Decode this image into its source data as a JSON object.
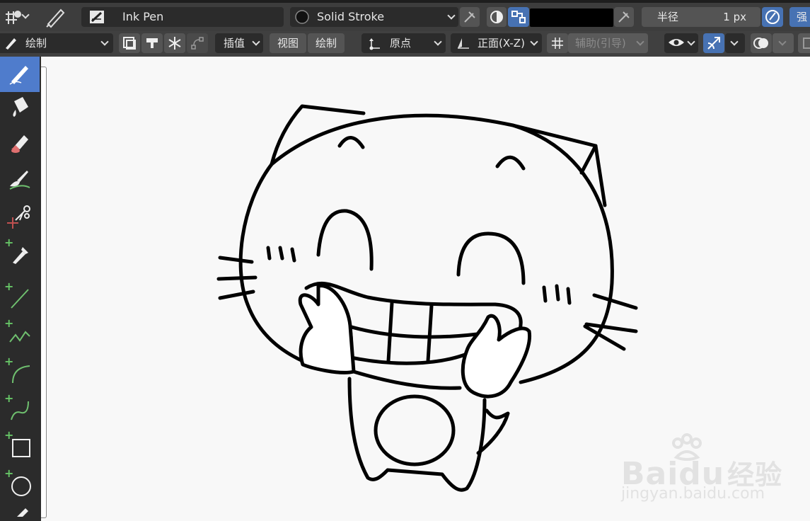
{
  "header": {
    "brush_name": "Ink Pen",
    "material_name": "Solid Stroke",
    "color_value": "#000000",
    "radius_label": "半径",
    "radius_value": "1 px",
    "strength_label_partial": "强"
  },
  "toolbar2": {
    "mode_label": "绘制",
    "interpolate_label": "插值",
    "view_menu": "视图",
    "draw_menu": "绘制",
    "origin_label": "原点",
    "plane_label": "正面(X-Z)",
    "guide_label": "辅助(引导)"
  },
  "tools": [
    {
      "name": "draw-tool",
      "icon": "pencil-icon"
    },
    {
      "name": "fill-tool",
      "icon": "paint-bucket-icon"
    },
    {
      "name": "erase-tool",
      "icon": "eraser-icon"
    },
    {
      "name": "tint-tool",
      "icon": "brush-icon"
    },
    {
      "name": "cutter-tool",
      "icon": "scissors-icon"
    },
    {
      "name": "eyedropper-tool",
      "icon": "eyedropper-icon"
    },
    {
      "name": "line-tool",
      "icon": "line-icon"
    },
    {
      "name": "polyline-tool",
      "icon": "polyline-icon"
    },
    {
      "name": "arc-tool",
      "icon": "arc-icon"
    },
    {
      "name": "curve-tool",
      "icon": "curve-icon"
    },
    {
      "name": "box-tool",
      "icon": "box-icon"
    },
    {
      "name": "circle-tool",
      "icon": "circle-icon"
    }
  ],
  "watermark": {
    "brand": "Baidu",
    "brand_cn": "经验",
    "url": "jingyan.baidu.com"
  },
  "colors": {
    "header_bg": "#3d3d3d",
    "field_bg": "#2b2b2b",
    "button_bg": "#545454",
    "accent_blue": "#4772b3",
    "canvas_bg": "#f8f8f8",
    "stroke": "#000000"
  }
}
